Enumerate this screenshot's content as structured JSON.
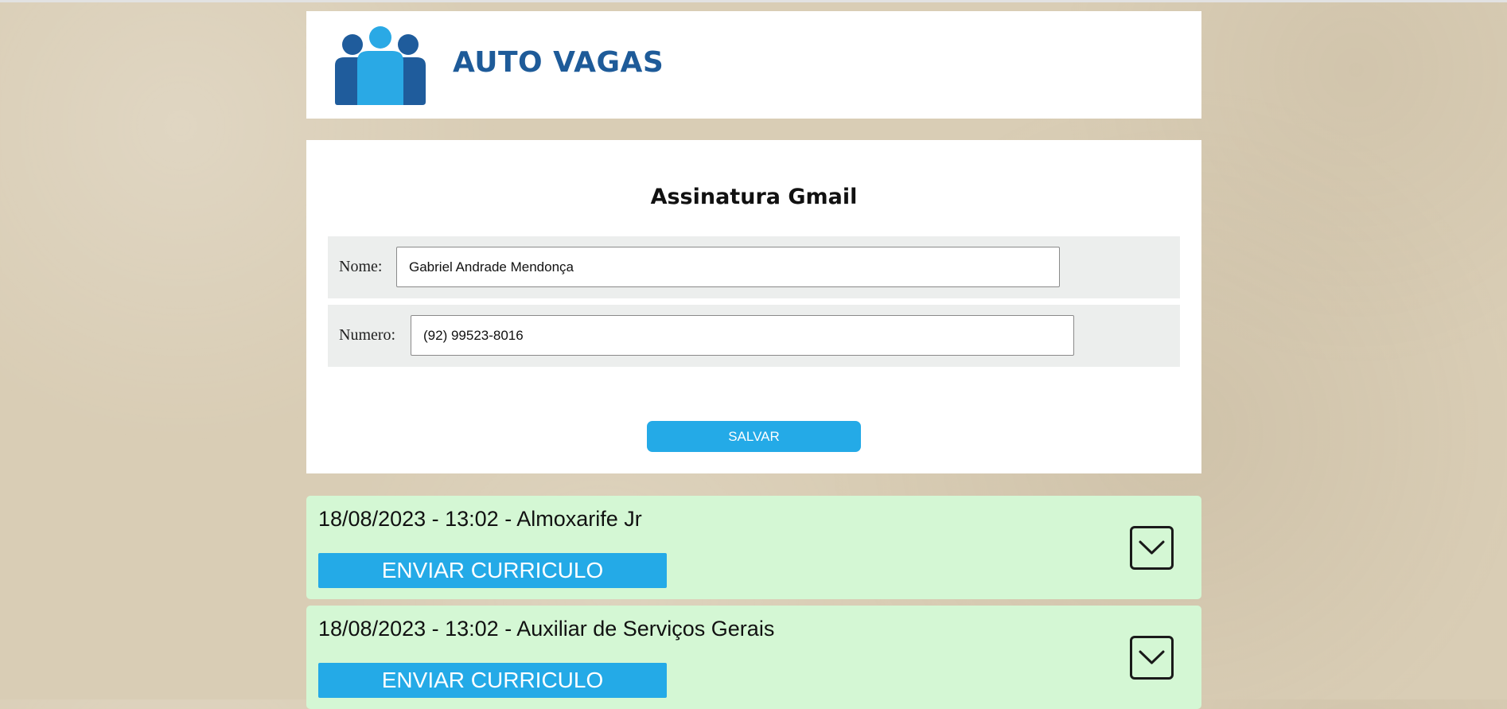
{
  "header": {
    "brand": "AUTO VAGAS",
    "logo_icon": "people-group-icon",
    "brand_color": "#1e5b99"
  },
  "signature_form": {
    "title": "Assinatura Gmail",
    "name_label": "Nome:",
    "name_value": "Gabriel Andrade Mendonça",
    "number_label": "Numero:",
    "number_value": "(92) 99523-8016",
    "save_label": "SALVAR",
    "button_color": "#24aae7"
  },
  "jobs": [
    {
      "title": "18/08/2023 - 13:02 - Almoxarife Jr",
      "send_label": "ENVIAR CURRICULO",
      "toggle_icon": "chevron-down-icon"
    },
    {
      "title": "18/08/2023 - 13:02 - Auxiliar de Serviços Gerais",
      "send_label": "ENVIAR CURRICULO",
      "toggle_icon": "chevron-down-icon"
    }
  ],
  "colors": {
    "page_background": "#d9cdb5",
    "job_card": "#d4f7d4",
    "field_row": "#eceeed"
  }
}
